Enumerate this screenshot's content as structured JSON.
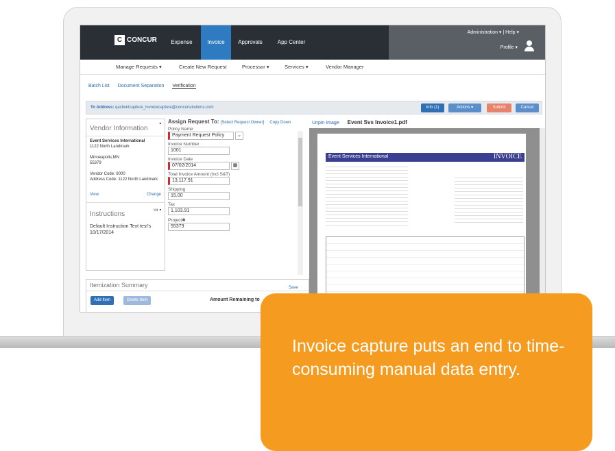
{
  "app": {
    "logo_letter": "C",
    "logo_text": "CONCUR"
  },
  "nav": {
    "tabs": [
      "Expense",
      "Invoice",
      "Approvals",
      "App Center"
    ],
    "active": "Invoice",
    "admin": "Administration ▾   |   Help ▾",
    "profile": "Profile ▾"
  },
  "subnav": [
    "Manage Requests ▾",
    "Create New Request",
    "Processor ▾",
    "Services ▾",
    "Vendor Manager"
  ],
  "sublinks": [
    "Batch List",
    "Document Separation",
    "Verification"
  ],
  "address": {
    "label": "To Address:",
    "value": "qaclientcapture_invoicecapture@concursolutions.com"
  },
  "buttons": {
    "info": "Info (1)",
    "actions": "Actions ▾",
    "submit": "Submit",
    "cancel": "Cancel"
  },
  "vendor": {
    "title": "Vendor Information",
    "name": "Event Services International",
    "addr1": "1122 North Landmark",
    "addr2": "Minneapolis,MN",
    "zip": "55379",
    "code": "Vendor Code: 8000",
    "acode": "Address Code: 1122 North Landmark",
    "view": "View",
    "change": "Change"
  },
  "instructions": {
    "title": "Instructions",
    "text": "Default Instruction Text test's 10/17/2014"
  },
  "assign": {
    "title": "Assign Request To:",
    "select": "[Select Request Owner]",
    "copy": "Copy Down",
    "unpin": "Unpin Image",
    "file": "Event Svs Invoice1.pdf"
  },
  "form": {
    "policy_label": "Policy Name",
    "policy": "Payment Request Policy",
    "inv_num_label": "Invoice Number",
    "inv_num": "1001",
    "inv_date_label": "Invoice Date",
    "inv_date": "07/02/2014",
    "total_label": "Total Invoice Amount (incl S&T)",
    "total": "13,117.91",
    "ship_label": "Shipping",
    "ship": "15.00",
    "tax_label": "Tax",
    "tax": "1,103.91",
    "proj_label": "Project✱",
    "proj": "55379",
    "save": "Save"
  },
  "itemization": {
    "title": "Itemization Summary",
    "add": "Add Item",
    "delete": "Delete Item",
    "remaining": "Amount Remaining to"
  },
  "invoice_doc": {
    "company": "Event Services International",
    "word": "INVOICE"
  },
  "callout": "Invoice capture puts an end to time-consuming manual data entry."
}
